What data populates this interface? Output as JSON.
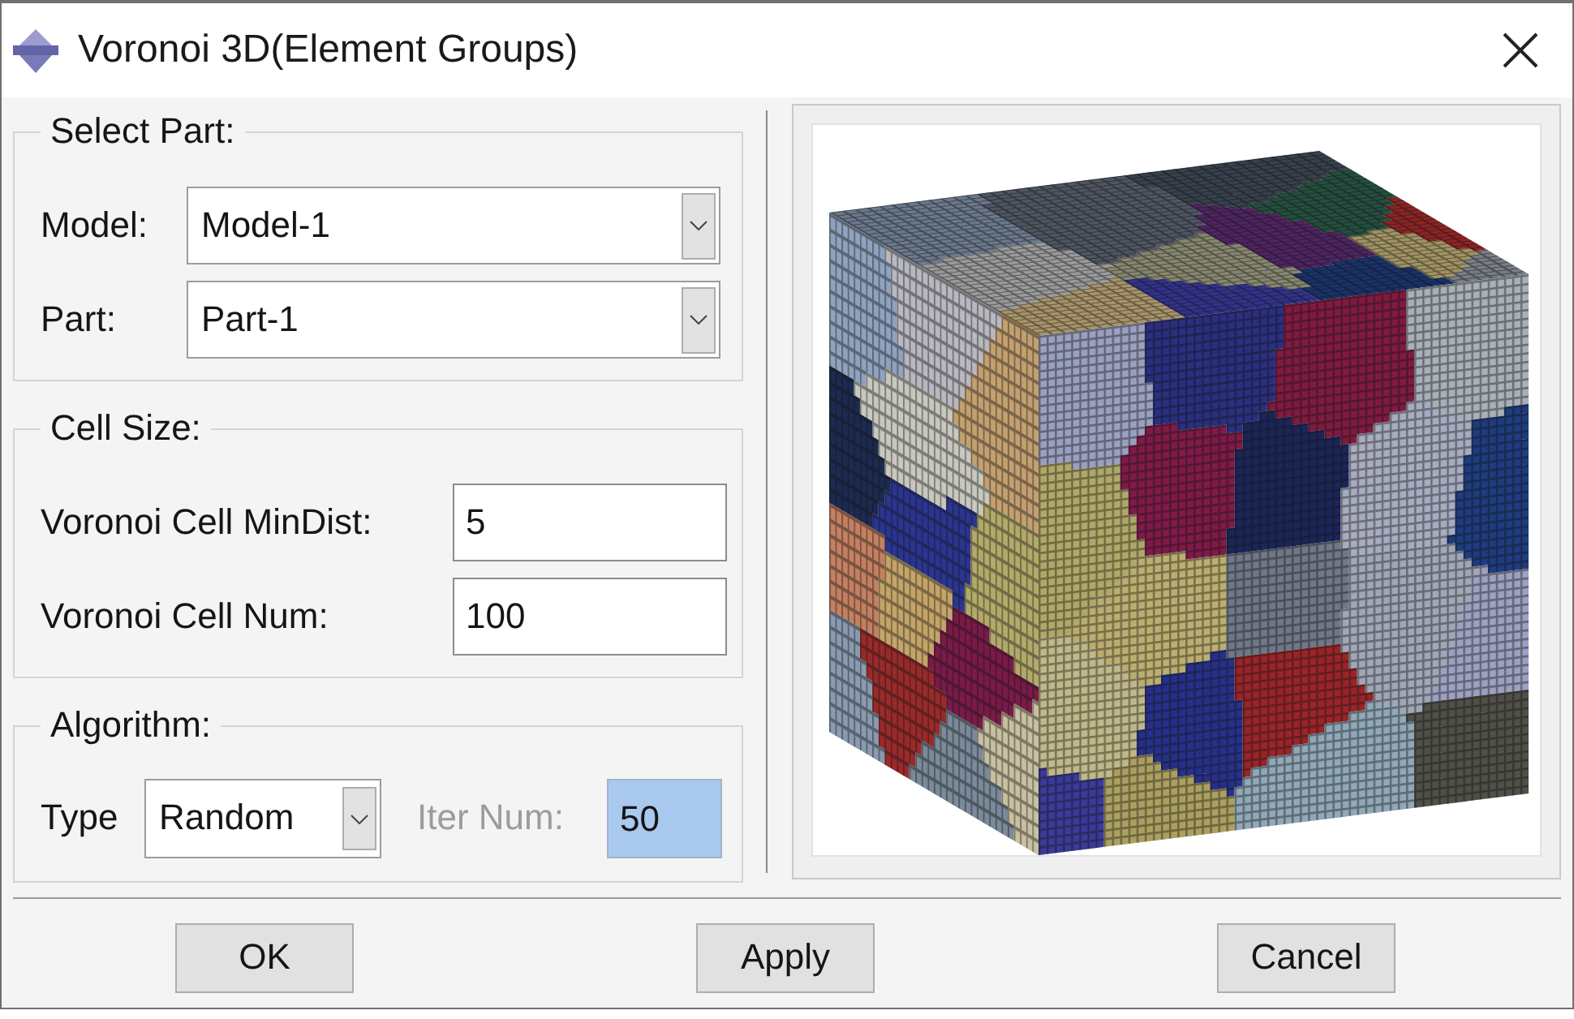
{
  "window": {
    "title": "Voronoi 3D(Element Groups)"
  },
  "select_part": {
    "title": "Select Part:",
    "rows": [
      {
        "label": "Model:",
        "value": "Model-1"
      },
      {
        "label": "Part:",
        "value": "Part-1"
      }
    ]
  },
  "cell_size": {
    "title": "Cell Size:",
    "rows": [
      {
        "label": "Voronoi Cell MinDist:",
        "value": "5"
      },
      {
        "label": "Voronoi Cell Num:",
        "value": "100"
      }
    ]
  },
  "algorithm": {
    "title": "Algorithm:",
    "type": {
      "label": "Type",
      "value": "Random"
    },
    "iter_num": {
      "label": "Iter Num:",
      "value": "50",
      "disabled": true,
      "selected": true
    }
  },
  "buttons": [
    {
      "label": "OK"
    },
    {
      "label": "Apply"
    },
    {
      "label": "Cancel"
    }
  ]
}
